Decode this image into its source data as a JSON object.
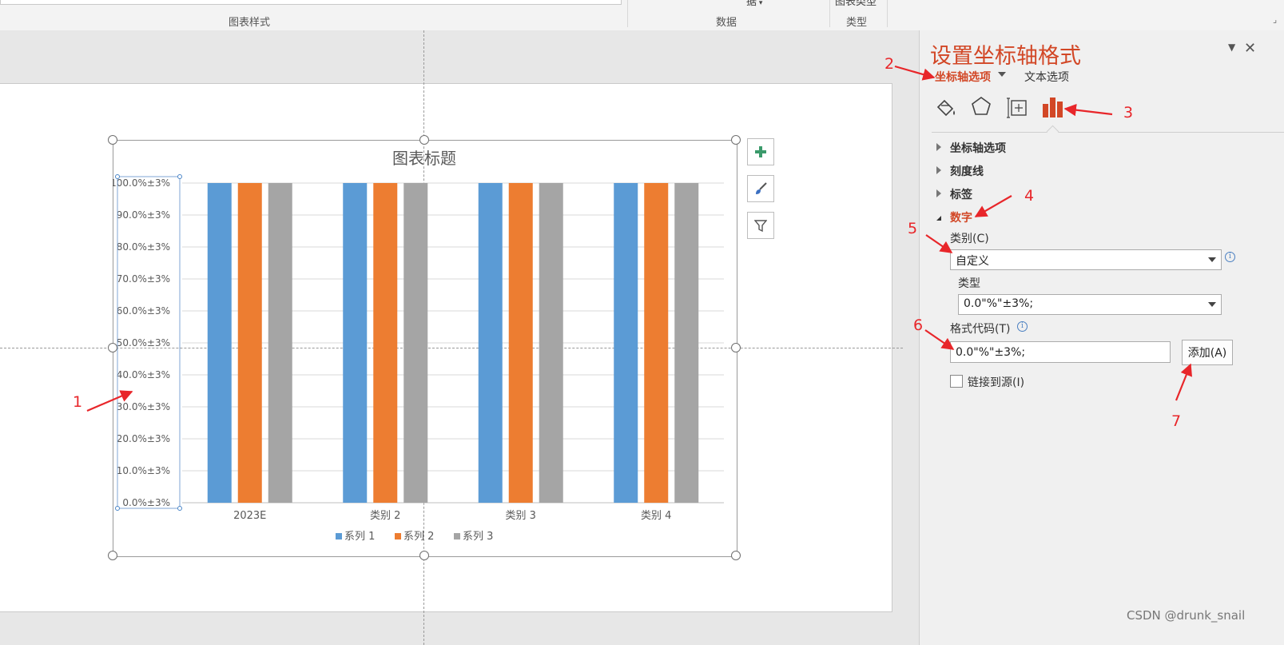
{
  "ribbon": {
    "group_chart_styles": "图表样式",
    "group_data": "数据",
    "group_type": "类型",
    "cut_data_text": "据",
    "cut_type_text": "图表类型"
  },
  "chart": {
    "title": "图表标题",
    "side_buttons": [
      "chart-elements-button",
      "chart-styles-button",
      "chart-filters-button"
    ]
  },
  "chart_data": {
    "type": "bar",
    "title": "图表标题",
    "categories": [
      "2023E",
      "类别 2",
      "类别 3",
      "类别 4"
    ],
    "series": [
      {
        "name": "系列 1",
        "color": "#5b9bd5",
        "values": [
          1.0,
          1.0,
          1.0,
          1.0
        ]
      },
      {
        "name": "系列 2",
        "color": "#ed7d31",
        "values": [
          1.0,
          1.0,
          1.0,
          1.0
        ]
      },
      {
        "name": "系列 3",
        "color": "#a5a5a5",
        "values": [
          1.0,
          1.0,
          1.0,
          1.0
        ]
      }
    ],
    "yticks": [
      "0.0%±3%",
      "10.0%±3%",
      "20.0%±3%",
      "30.0%±3%",
      "40.0%±3%",
      "50.0%±3%",
      "60.0%±3%",
      "70.0%±3%",
      "80.0%±3%",
      "90.0%±3%",
      "100.0%±3%"
    ],
    "ylim": [
      0,
      1
    ],
    "grid": true,
    "legend": "bottom",
    "xlabel": "",
    "ylabel": ""
  },
  "pane": {
    "title": "设置坐标轴格式",
    "tab_axis_options": "坐标轴选项",
    "tab_text_options": "文本选项",
    "icons": [
      "fill-line-icon",
      "effects-icon",
      "size-properties-icon",
      "axis-options-icon"
    ],
    "sections": {
      "axis_options": "坐标轴选项",
      "tick_marks": "刻度线",
      "labels": "标签",
      "number": "数字"
    },
    "category_label": "类别(C)",
    "category_value": "自定义",
    "type_label": "类型",
    "type_value": "0.0\"%\"±3%;",
    "format_code_label": "格式代码(T)",
    "format_code_value": "0.0\"%\"±3%;",
    "add_button": "添加(A)",
    "link_to_source": "链接到源(I)"
  },
  "annotations": [
    "1",
    "2",
    "3",
    "4",
    "5",
    "6",
    "7"
  ],
  "annotation_color": "#e8262a",
  "accent_color": "#d24726",
  "watermark": "CSDN @drunk_snail"
}
